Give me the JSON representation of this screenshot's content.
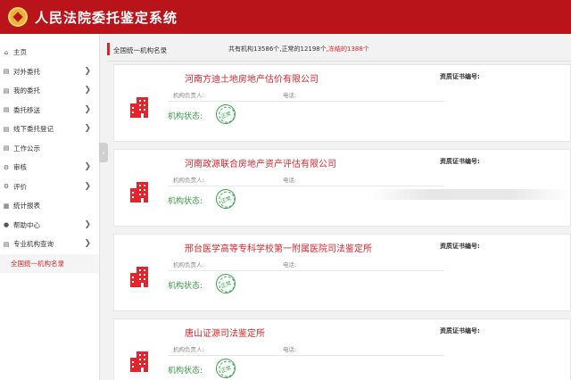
{
  "header": {
    "title": "人民法院委托鉴定系统"
  },
  "sidebar": {
    "items": [
      {
        "label": "主页",
        "icon": "home-icon",
        "glyph": "⌂",
        "chevron": false
      },
      {
        "label": "对外委托",
        "icon": "doc-icon",
        "glyph": "▤",
        "chevron": true
      },
      {
        "label": "我的委托",
        "icon": "doc-icon",
        "glyph": "▤",
        "chevron": true
      },
      {
        "label": "委托移送",
        "icon": "doc-icon",
        "glyph": "▤",
        "chevron": true
      },
      {
        "label": "线下委托登记",
        "icon": "doc-icon",
        "glyph": "▤",
        "chevron": true
      },
      {
        "label": "工作公示",
        "icon": "doc-icon",
        "glyph": "▤",
        "chevron": false
      },
      {
        "label": "审核",
        "icon": "gear-icon",
        "glyph": "⚙",
        "chevron": true
      },
      {
        "label": "评价",
        "icon": "gear-icon",
        "glyph": "⚙",
        "chevron": true
      },
      {
        "label": "统计报表",
        "icon": "chart-icon",
        "glyph": "▦",
        "chevron": false
      },
      {
        "label": "帮助中心",
        "icon": "help-icon",
        "glyph": "●",
        "chevron": true
      },
      {
        "label": "专业机构查询",
        "icon": "doc-icon",
        "glyph": "▤",
        "chevron": true
      }
    ],
    "active_label": "全国统一机构名录"
  },
  "main": {
    "section_title": "全国统一机构名录",
    "stats": {
      "prefix": "共有机构13586个,正常的12198个,",
      "frozen": "冻结的1388个"
    },
    "labels": {
      "cert": "资质证书编号:",
      "head": "机构负责人:",
      "tel": "电话:",
      "status": "机构状态:",
      "stamp": "正常"
    },
    "cards": [
      {
        "name": "河南方迪土地房地产估价有限公司"
      },
      {
        "name": "河南政源联合房地产资产评估有限公司"
      },
      {
        "name": "邢台医学高等专科学校第一附属医院司法鉴定所"
      },
      {
        "name": "唐山证源司法鉴定所"
      }
    ]
  },
  "colors": {
    "brand_red": "#b8141a",
    "accent_red": "#d8262d",
    "status_green": "#3aa64d"
  }
}
